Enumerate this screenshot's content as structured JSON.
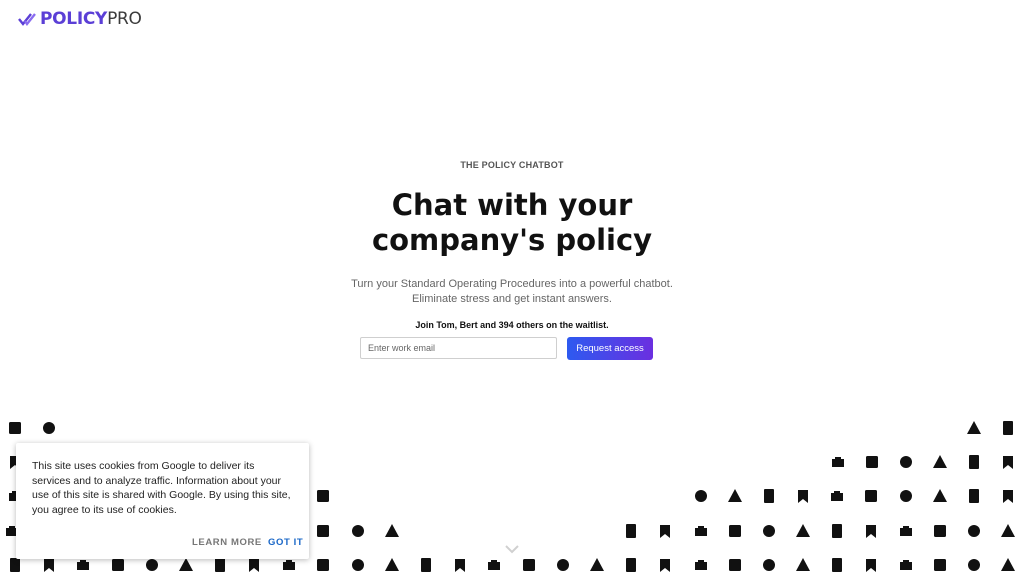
{
  "brand": {
    "bold": "POLICY",
    "light": "PRO",
    "color": "#5b3fd6"
  },
  "hero": {
    "eyebrow": "THE POLICY CHATBOT",
    "headline_line1": "Chat with your",
    "headline_line2": "company's policy",
    "sub_line1": "Turn your Standard Operating Procedures into a powerful chatbot.",
    "sub_line2": "Eliminate stress and get instant answers.",
    "waitlist": "Join Tom, Bert and 394 others on the waitlist."
  },
  "form": {
    "email_placeholder": "Enter work email",
    "button_label": "Request access"
  },
  "cookie": {
    "text": "This site uses cookies from Google to deliver its services and to analyze traffic. Information about your use of this site is shared with Google. By using this site, you agree to its use of cookies.",
    "learn_more": "LEARN MORE",
    "got_it": "GOT IT"
  },
  "icons": [
    "gavel-icon",
    "download-icon",
    "clipboard-icon",
    "contact-clipboard-icon",
    "sync-icon",
    "add-to-calendar-icon",
    "download-box-icon",
    "checkbox-icon",
    "refresh-icon",
    "cloud-upload-icon",
    "book-icon",
    "star-icon",
    "hourglass-icon",
    "bookmark-icon",
    "bookmark-outline-icon",
    "bookmarks-icon",
    "bug-icon",
    "wrench-icon",
    "sync-alt-icon",
    "calendar-icon",
    "credit-card-icon",
    "camera-icon",
    "card-giftcard-icon",
    "https-icon",
    "label-outline-icon",
    "alarm-icon",
    "translate-icon",
    "report-icon",
    "gps-icon",
    "dns-icon",
    "work-icon",
    "warning-outline-icon",
    "check-circle-icon",
    "check-outline-icon",
    "chrome-reader-icon",
    "book-outline-icon",
    "code-icon",
    "rv-icon",
    "compare-arrows-icon",
    "no-sim-icon",
    "label-icon",
    "language-icon",
    "open-in-new-icon",
    "lightbulb-icon",
    "view-day-icon",
    "view-headline-icon",
    "list-icon",
    "lock-icon",
    "lock-open-icon",
    "person-icon",
    "photo-library-icon",
    "phone-forwarded-icon",
    "wifi-icon",
    "pets-icon",
    "picture-in-picture-icon",
    "pip-outline-icon",
    "get-app-icon",
    "code-off-icon",
    "power-icon",
    "help-icon",
    "copyright-icon",
    "payment-icon",
    "dashboard-icon",
    "date-range-icon",
    "delete-icon",
    "delete-forever-icon",
    "delete-outline-icon",
    "description-icon",
    "web-icon"
  ]
}
